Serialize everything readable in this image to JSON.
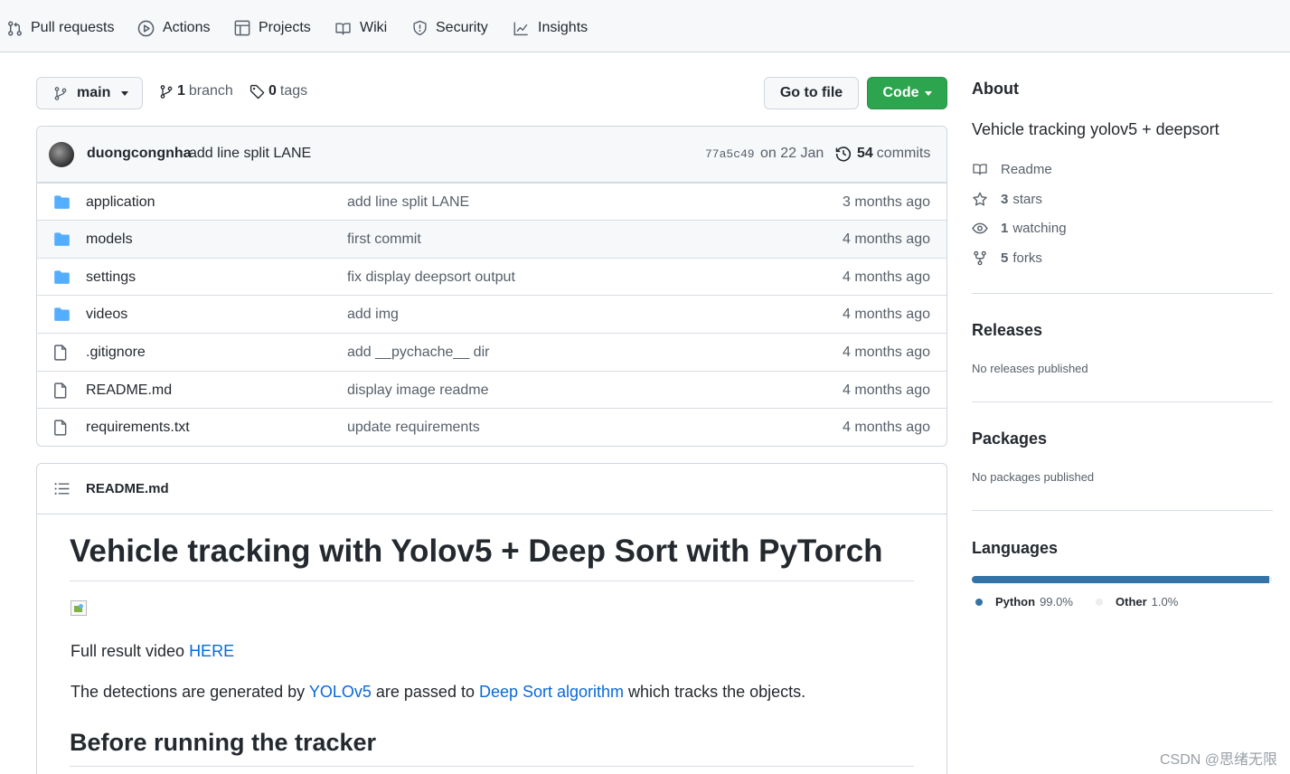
{
  "nav": {
    "items": [
      {
        "label": "Pull requests",
        "icon": "pull-request-icon"
      },
      {
        "label": "Actions",
        "icon": "play-icon"
      },
      {
        "label": "Projects",
        "icon": "table-icon"
      },
      {
        "label": "Wiki",
        "icon": "book-icon"
      },
      {
        "label": "Security",
        "icon": "shield-icon"
      },
      {
        "label": "Insights",
        "icon": "graph-icon"
      }
    ]
  },
  "toolbar": {
    "branch": "main",
    "branch_count": "1",
    "branch_label": "branch",
    "tag_count": "0",
    "tag_label": "tags",
    "go_to_file": "Go to file",
    "code": "Code",
    "code_color": "#2da44e"
  },
  "commit": {
    "author": "duongcongnha",
    "message": "add line split LANE",
    "sha": "77a5c49",
    "date": "on 22 Jan",
    "count": "54",
    "count_label": "commits"
  },
  "files": [
    {
      "name": "application",
      "type": "dir",
      "message": "add line split LANE",
      "age": "3 months ago"
    },
    {
      "name": "models",
      "type": "dir",
      "message": "first commit",
      "age": "4 months ago"
    },
    {
      "name": "settings",
      "type": "dir",
      "message": "fix display deepsort output",
      "age": "4 months ago"
    },
    {
      "name": "videos",
      "type": "dir",
      "message": "add img",
      "age": "4 months ago"
    },
    {
      "name": ".gitignore",
      "type": "file",
      "message": "add __pychache__ dir",
      "age": "4 months ago"
    },
    {
      "name": "README.md",
      "type": "file",
      "message": "display image readme",
      "age": "4 months ago"
    },
    {
      "name": "requirements.txt",
      "type": "file",
      "message": "update requirements",
      "age": "4 months ago"
    }
  ],
  "readme": {
    "filename": "README.md",
    "h1": "Vehicle tracking with Yolov5 + Deep Sort with PyTorch",
    "p1_text": "Full result video ",
    "p1_link": "HERE",
    "p2_a": "The detections are generated by ",
    "p2_link1": "YOLOv5",
    "p2_b": " are passed to ",
    "p2_link2": "Deep Sort algorithm",
    "p2_c": " which tracks the objects.",
    "h2": "Before running the tracker"
  },
  "sidebar": {
    "about_title": "About",
    "description": "Vehicle tracking yolov5 + deepsort",
    "readme_label": "Readme",
    "stars_count": "3",
    "stars_label": "stars",
    "watching_count": "1",
    "watching_label": "watching",
    "forks_count": "5",
    "forks_label": "forks",
    "releases_title": "Releases",
    "releases_note": "No releases published",
    "packages_title": "Packages",
    "packages_note": "No packages published",
    "languages_title": "Languages",
    "languages": [
      {
        "name": "Python",
        "percent": "99.0%",
        "value": 99.0,
        "color": "#3572A5"
      },
      {
        "name": "Other",
        "percent": "1.0%",
        "value": 1.0,
        "color": "#ededed"
      }
    ]
  },
  "watermark": "CSDN @思绪无限"
}
